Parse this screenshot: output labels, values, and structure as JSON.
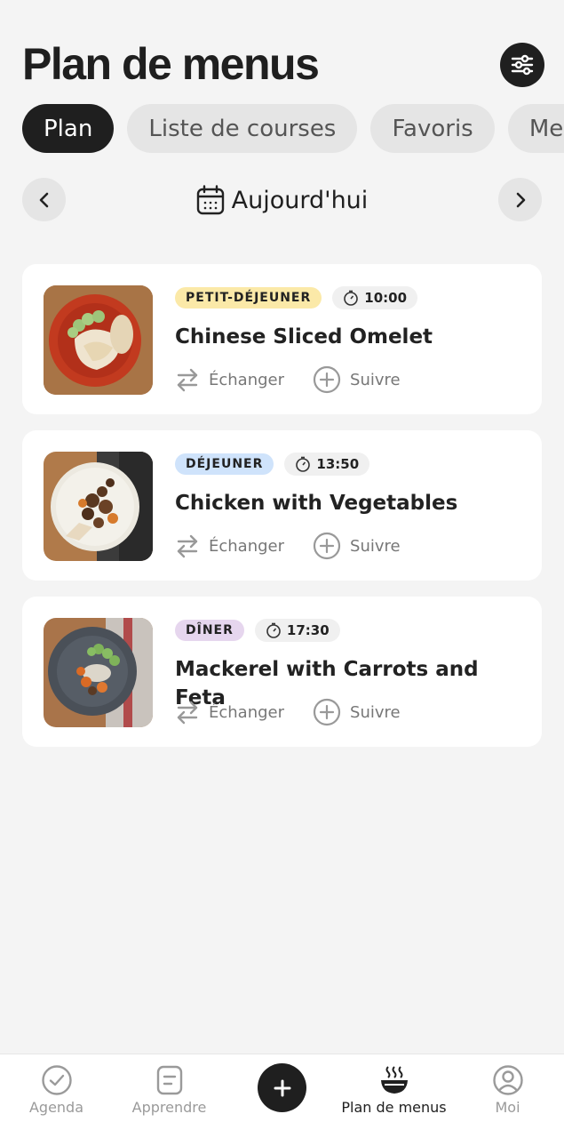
{
  "header": {
    "title": "Plan de menus",
    "filter_icon": "sliders-icon"
  },
  "tabs": [
    {
      "label": "Plan",
      "active": true
    },
    {
      "label": "Liste de courses",
      "active": false
    },
    {
      "label": "Favoris",
      "active": false
    },
    {
      "label": "Mes",
      "active": false
    }
  ],
  "day_nav": {
    "label": "Aujourd'hui",
    "prev_icon": "chevron-left-icon",
    "next_icon": "chevron-right-icon",
    "calendar_icon": "calendar-icon"
  },
  "meals": [
    {
      "badge": "PETIT-DÉJEUNER",
      "badge_color": "#fbe9a8",
      "time": "10:00",
      "title": "Chinese Sliced Omelet",
      "swap_label": "Échanger",
      "track_label": "Suivre"
    },
    {
      "badge": "DÉJEUNER",
      "badge_color": "#cfe3fb",
      "time": "13:50",
      "title": "Chicken with Vegetables",
      "swap_label": "Échanger",
      "track_label": "Suivre"
    },
    {
      "badge": "DÎNER",
      "badge_color": "#e6d6ee",
      "time": "17:30",
      "title": "Mackerel with Carrots and Feta",
      "swap_label": "Échanger",
      "track_label": "Suivre"
    }
  ],
  "bottom_nav": [
    {
      "label": "Agenda",
      "icon": "check-circle-icon",
      "active": false
    },
    {
      "label": "Apprendre",
      "icon": "document-icon",
      "active": false
    },
    {
      "label": "Plan de menus",
      "icon": "bowl-icon",
      "active": true
    },
    {
      "label": "Moi",
      "icon": "user-circle-icon",
      "active": false
    }
  ],
  "fab_icon": "plus-icon"
}
